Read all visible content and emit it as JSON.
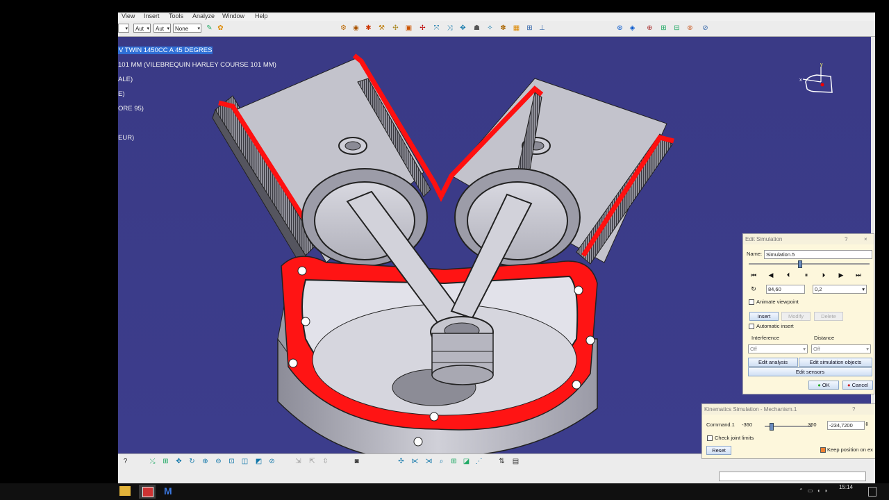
{
  "menu": {
    "items": [
      "View",
      "Insert",
      "Tools",
      "Analyze",
      "Window",
      "Help"
    ]
  },
  "toolbar_top": {
    "combo1": "Aut",
    "combo2": "Aut",
    "combo3": "None"
  },
  "tree": {
    "items": [
      "V TWIN 1450CC A 45 DEGRES",
      "101 MM (VILEBREQUIN HARLEY COURSE 101 MM)",
      "ALE)",
      "E)",
      "ORE 95)",
      "",
      "EUR)"
    ]
  },
  "compass": {
    "axis_x": "x",
    "axis_y": "y"
  },
  "edit_simulation": {
    "title": "Edit Simulation",
    "help": "?",
    "close": "×",
    "name_label": "Name:",
    "name_value": "Simulation.5",
    "slider_fraction": 0.42,
    "position_value": "84,60",
    "step_value": "0,2",
    "animate_viewpoint": "Animate viewpoint",
    "insert": "Insert",
    "modify": "Modify",
    "delete": "Delete",
    "automatic_insert": "Automatic insert",
    "interference_label": "Interference",
    "interference_value": "Off",
    "distance_label": "Distance",
    "distance_value": "Off",
    "edit_analysis": "Edit analysis",
    "edit_sim_objects": "Edit simulation objects",
    "edit_sensors": "Edit sensors",
    "ok": "OK",
    "cancel": "Cancel"
  },
  "kinematics": {
    "title": "Kinematics Simulation - Mechanism.1",
    "help": "?",
    "command_label": "Command.1",
    "min": "-360",
    "max": "360",
    "value": "-234,7200",
    "slider_fraction": 0.02,
    "check_joint_limits": "Check joint limits",
    "reset": "Reset",
    "keep_position": "Keep position on ex"
  },
  "taskbar": {
    "clock": "15:14"
  },
  "colors": {
    "viewport_bg": "#3b3c89",
    "gasket_red": "#ff1010",
    "part_grey": "#c9c9d1",
    "dialog_bg": "#fdf7dc",
    "tree_selection": "#2f6fd6"
  }
}
